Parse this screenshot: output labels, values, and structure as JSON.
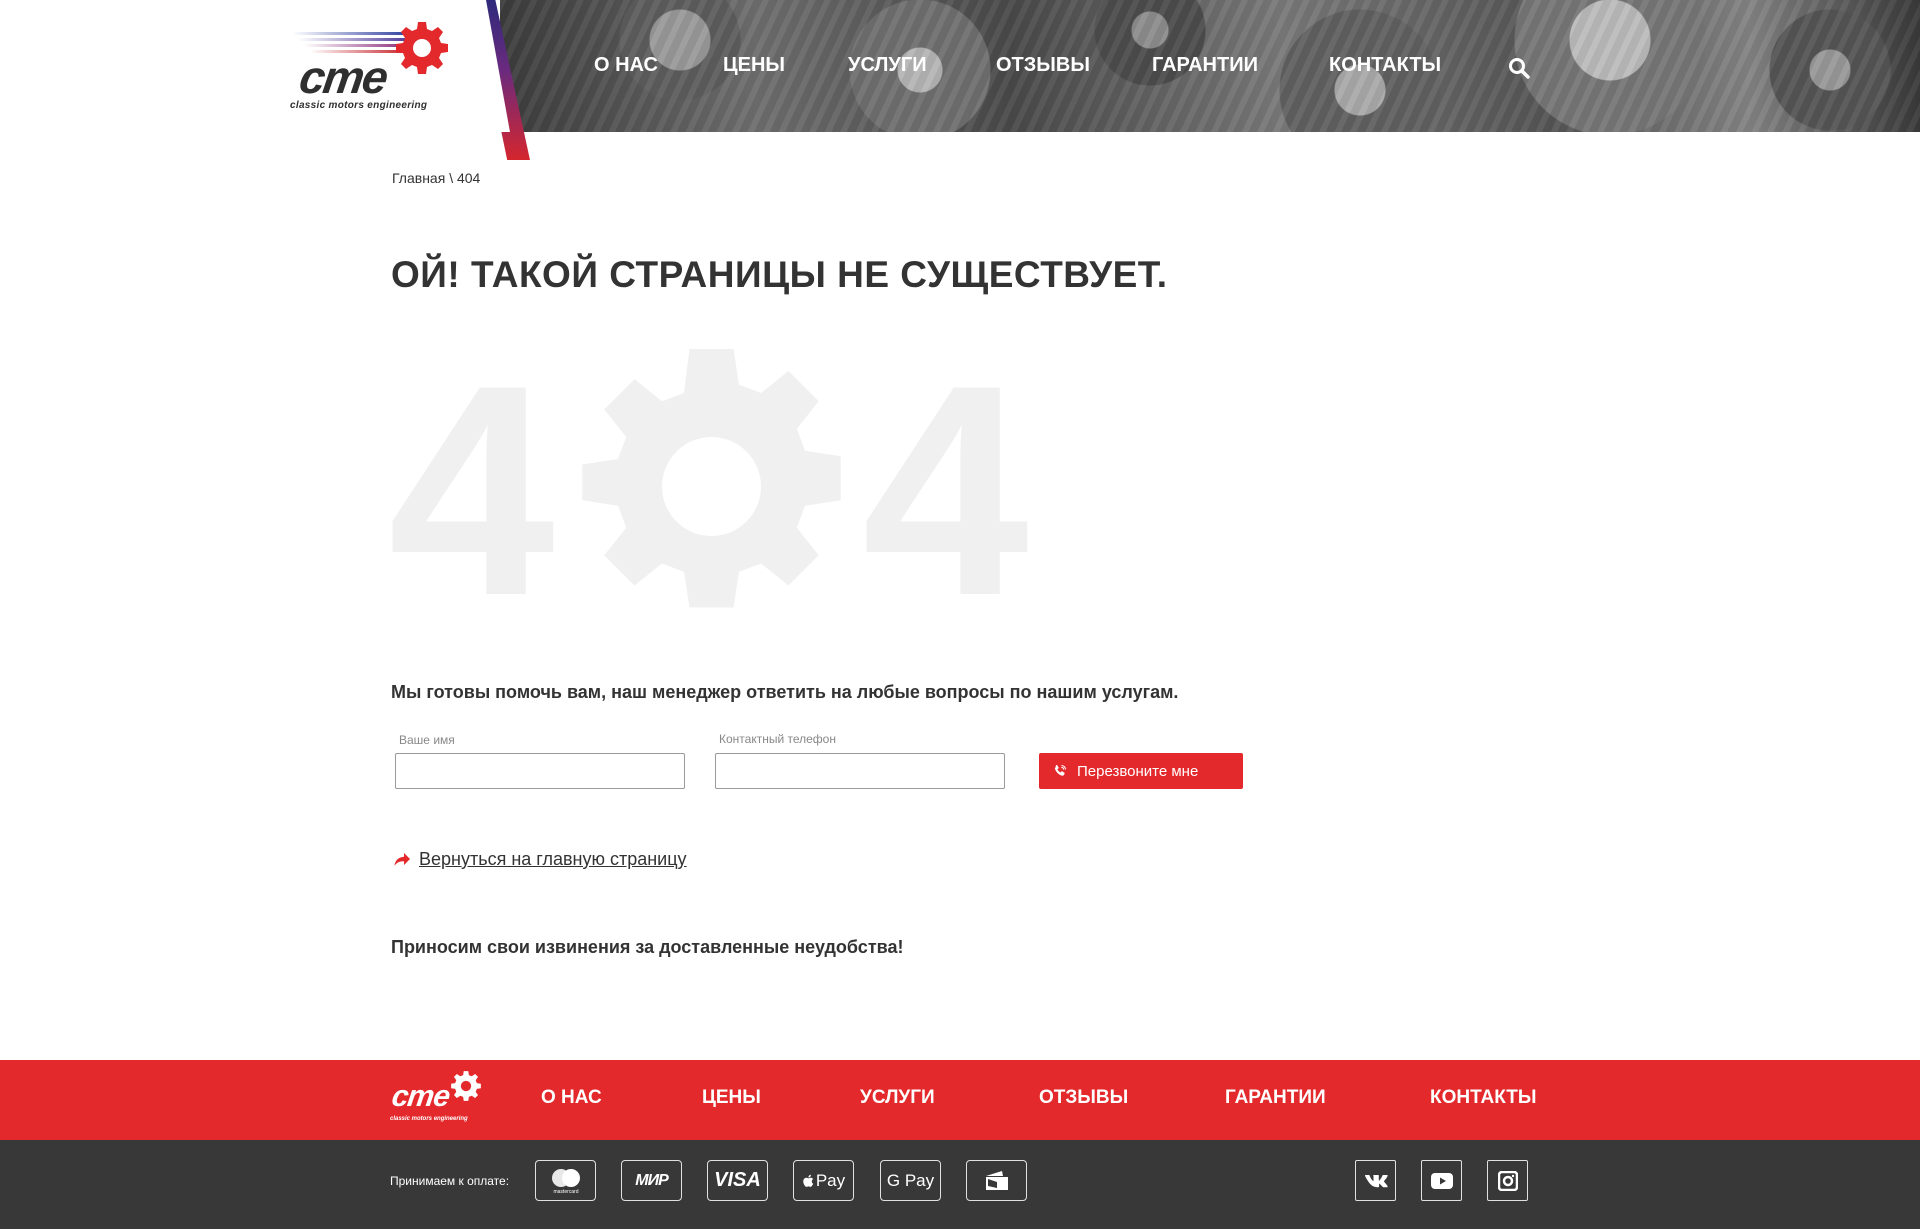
{
  "header": {
    "logo": {
      "text": "cme",
      "tagline": "classic motors engineering"
    },
    "nav": [
      "О НАС",
      "ЦЕНЫ",
      "УСЛУГИ",
      "ОТЗЫВЫ",
      "ГАРАНТИИ",
      "КОНТАКТЫ"
    ],
    "search_icon": "search-icon"
  },
  "breadcrumb": {
    "home": "Главная",
    "separator": "\\",
    "current": "404"
  },
  "main": {
    "title": "ОЙ! ТАКОЙ СТРАНИЦЫ НЕ СУЩЕСТВУЕТ.",
    "error_digit_left": "4",
    "error_digit_right": "4",
    "error_gear_icon": "gear-icon",
    "help_text": "Мы готовы помочь вам, наш менеджер ответить на любые вопросы по нашим услугам.",
    "form": {
      "name_label": "Ваше имя",
      "name_value": "",
      "phone_label": "Контактный телефон",
      "phone_value": "",
      "submit_label": "Перезвоните мне",
      "submit_icon": "phone-icon"
    },
    "back_link": "Вернуться на главную страницу",
    "apology": "Приносим свои извинения за доставленные неудобства!"
  },
  "footer": {
    "logo": {
      "text": "cme",
      "tagline": "classic motors engineering"
    },
    "nav": [
      "О НАС",
      "ЦЕНЫ",
      "УСЛУГИ",
      "ОТЗЫВЫ",
      "ГАРАНТИИ",
      "КОНТАКТЫ"
    ],
    "payment_label": "Принимаем к оплате:",
    "payments": [
      "mastercard",
      "МИР",
      "VISA",
      "Pay",
      "G Pay",
      "wallet-icon"
    ],
    "social": [
      "vk-icon",
      "youtube-icon",
      "instagram-icon"
    ]
  },
  "colors": {
    "accent": "#e3292c",
    "text": "#333333",
    "footer_dark": "#383838",
    "watermark": "#f0f0f0"
  }
}
